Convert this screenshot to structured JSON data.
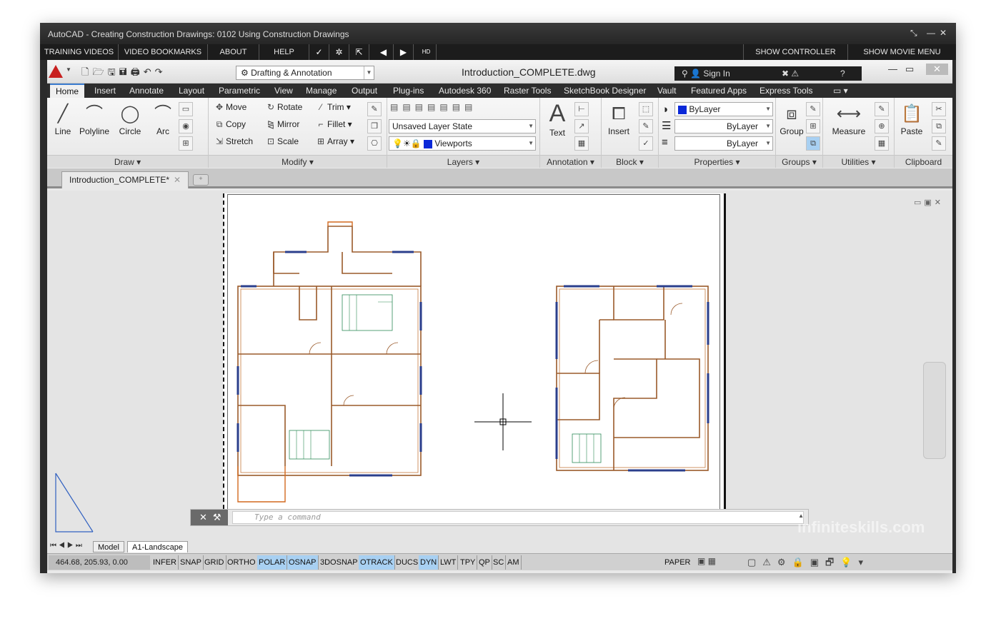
{
  "window": {
    "title": "AutoCAD - Creating Construction Drawings: 0102 Using Construction Drawings",
    "controls": [
      "⤡",
      "—",
      "✕"
    ]
  },
  "menu": {
    "items": [
      "TRAINING VIDEOS",
      "VIDEO BOOKMARKS",
      "ABOUT",
      "HELP"
    ],
    "right": [
      "SHOW CONTROLLER",
      "SHOW MOVIE MENU"
    ]
  },
  "qat": {
    "workspace": "Drafting & Annotation",
    "document_title": "Introduction_COMPLETE.dwg",
    "sign_in": "Sign In"
  },
  "ribbon_tabs": [
    "Home",
    "Insert",
    "Annotate",
    "Layout",
    "Parametric",
    "View",
    "Manage",
    "Output",
    "Plug-ins",
    "Autodesk 360",
    "Raster Tools",
    "SketchBook Designer",
    "Vault",
    "Featured Apps",
    "Express Tools"
  ],
  "panels": {
    "draw": {
      "title": "Draw",
      "tools": [
        "Line",
        "Polyline",
        "Circle",
        "Arc"
      ]
    },
    "modify": {
      "title": "Modify",
      "tools": [
        "Move",
        "Rotate",
        "Trim",
        "Copy",
        "Mirror",
        "Fillet",
        "Stretch",
        "Scale",
        "Array"
      ]
    },
    "layers": {
      "title": "Layers",
      "layer_state": "Unsaved Layer State",
      "current_layer": "Viewports"
    },
    "annotation": {
      "title": "Annotation",
      "text_label": "Text"
    },
    "block": {
      "title": "Block",
      "insert_label": "Insert"
    },
    "properties": {
      "title": "Properties",
      "color": "ByLayer",
      "linetype": "ByLayer",
      "lineweight": "ByLayer"
    },
    "groups": {
      "title": "Groups",
      "group_label": "Group"
    },
    "utilities": {
      "title": "Utilities",
      "measure_label": "Measure"
    },
    "clipboard": {
      "title": "Clipboard",
      "paste_label": "Paste"
    }
  },
  "file_tab": "Introduction_COMPLETE*",
  "command_line": {
    "placeholder": "Type a command"
  },
  "layout_tabs": [
    "Model",
    "A1-Landscape"
  ],
  "status": {
    "coordinates": "464.68, 205.93, 0.00",
    "toggles": [
      {
        "label": "INFER",
        "on": false
      },
      {
        "label": "SNAP",
        "on": false
      },
      {
        "label": "GRID",
        "on": false
      },
      {
        "label": "ORTHO",
        "on": false
      },
      {
        "label": "POLAR",
        "on": true
      },
      {
        "label": "OSNAP",
        "on": true
      },
      {
        "label": "3DOSNAP",
        "on": false
      },
      {
        "label": "OTRACK",
        "on": true
      },
      {
        "label": "DUCS",
        "on": false
      },
      {
        "label": "DYN",
        "on": true
      },
      {
        "label": "LWT",
        "on": false
      },
      {
        "label": "TPY",
        "on": false
      },
      {
        "label": "QP",
        "on": false
      },
      {
        "label": "SC",
        "on": false
      },
      {
        "label": "AM",
        "on": false
      }
    ],
    "space": "PAPER"
  },
  "watermark": "infiniteskills.com",
  "colors": {
    "accent": "#3b7ccf",
    "status_on": "#a8d0f2",
    "wall": "#9a5a2a",
    "stair": "#2e8b57",
    "window": "#2b3f8c"
  }
}
